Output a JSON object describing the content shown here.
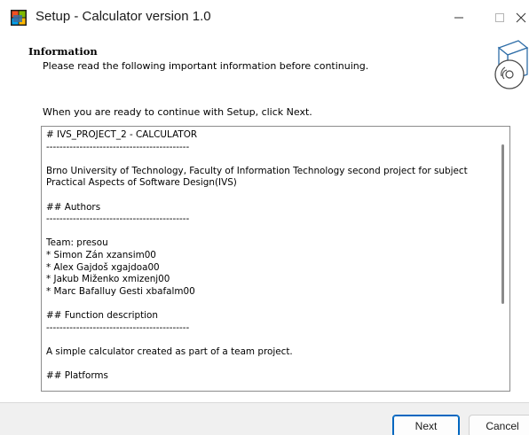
{
  "window": {
    "title": "Setup - Calculator version 1.0",
    "minimize_icon": "minimize-icon",
    "maximize_icon": "maximize-icon",
    "close_icon": "close-icon"
  },
  "header": {
    "title": "Information",
    "subtitle": "Please read the following important information before continuing.",
    "art_icon": "setup-disc-box-icon"
  },
  "body": {
    "ready_text": "When you are ready to continue with Setup, click Next."
  },
  "memo": {
    "lines": [
      "# IVS_PROJECT_2 - CALCULATOR",
      "-------------------------------------------",
      "",
      "Brno University of Technology, Faculty of Information Technology second project for subject Practical Aspects of Software Design(IVS)",
      "",
      "## Authors",
      "-------------------------------------------",
      "",
      "Team: presou",
      "* Simon Zán xzansim00",
      "* Alex Gajdoš xgajdoa00",
      "* Jakub Miženko xmizenj00",
      "* Marc Bafalluy Gesti xbafalm00",
      "",
      "## Function description",
      "-------------------------------------------",
      "",
      "A simple calculator created as part of a team project.",
      "",
      "## Platforms"
    ]
  },
  "buttons": {
    "next": "Next",
    "cancel": "Cancel"
  },
  "colors": {
    "accent": "#0067c0",
    "footer_bg": "#f0f0f0"
  }
}
